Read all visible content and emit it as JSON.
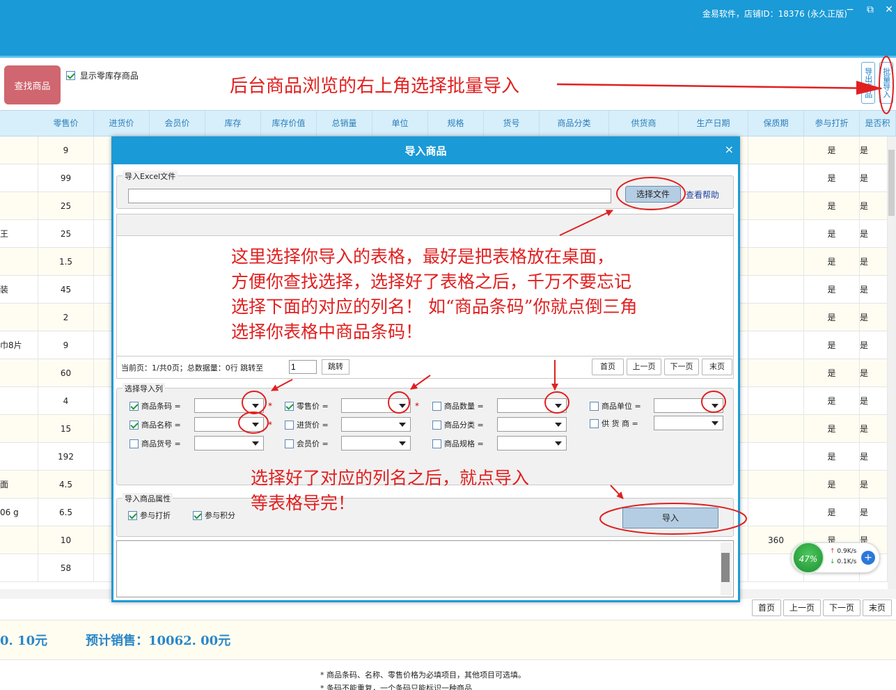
{
  "titlebar": {
    "text": "金易软件，店铺ID：18376 (永久正版)",
    "minimize": "−",
    "restore": "⧉",
    "close": "✕"
  },
  "toolbar": {
    "find_button": "查找商品",
    "show_zero_label": "显示零库存商品",
    "show_zero_checked": true,
    "export_label": "导出商品",
    "batch_import_label": "批量导入"
  },
  "table": {
    "columns": [
      "零售价",
      "进货价",
      "会员价",
      "库存",
      "库存价值",
      "总销量",
      "单位",
      "规格",
      "货号",
      "商品分类",
      "供货商",
      "生产日期",
      "保质期",
      "参与打折",
      "是否积"
    ],
    "name_fragments": [
      "",
      "",
      "",
      "王",
      "",
      "装",
      "",
      "巾8片",
      "",
      "",
      "",
      "",
      "面",
      "06 g",
      "",
      ""
    ],
    "retail_prices": [
      "9",
      "99",
      "25",
      "25",
      "1.5",
      "45",
      "2",
      "9",
      "60",
      "4",
      "15",
      "192",
      "4.5",
      "6.5",
      "10",
      "58"
    ],
    "shelf_life": [
      "",
      "",
      "",
      "",
      "",
      "",
      "",
      "",
      "",
      "",
      "",
      "",
      "",
      "",
      "360",
      ""
    ],
    "discount": [
      "是",
      "是",
      "是",
      "是",
      "是",
      "是",
      "是",
      "是",
      "是",
      "是",
      "是",
      "是",
      "是",
      "是",
      "是",
      "是"
    ],
    "points": [
      "是",
      "是",
      "是",
      "是",
      "是",
      "是",
      "是",
      "是",
      "是",
      "是",
      "是",
      "是",
      "是",
      "是",
      "是",
      "是"
    ]
  },
  "pager": {
    "first": "首页",
    "prev": "上一页",
    "next": "下一页",
    "last": "末页"
  },
  "footer": {
    "amount": "0. 10元",
    "expected_sales": "预计销售：10062. 00元",
    "note1": "* 商品条码、名称、零售价格为必填项目，其他项目可选填。",
    "note2": "* 条码不能重复，一个条码只能标识一种商品"
  },
  "dialog": {
    "title": "导入商品",
    "close": "×",
    "excel_group": "导入Excel文件",
    "file_value": "",
    "select_file": "选择文件",
    "help": "查看帮助",
    "pager_text": "当前页：1/共0页；总数据量：0行   跳转至",
    "jump_value": "1",
    "jump_btn": "跳转",
    "pager_first": "首页",
    "pager_prev": "上一页",
    "pager_next": "下一页",
    "pager_last": "末页",
    "columns_group": "选择导入列",
    "fields": {
      "barcode": {
        "label": "商品条码 =",
        "checked": true
      },
      "retail": {
        "label": "零售价 =",
        "checked": true
      },
      "qty": {
        "label": "商品数量 =",
        "checked": false
      },
      "unit": {
        "label": "商品单位 =",
        "checked": false
      },
      "name": {
        "label": "商品名称 =",
        "checked": true
      },
      "purchase": {
        "label": "进货价 =",
        "checked": false
      },
      "category": {
        "label": "商品分类 =",
        "checked": false
      },
      "supplier": {
        "label": "供 货 商 =",
        "checked": false
      },
      "itemno": {
        "label": "商品货号 =",
        "checked": false
      },
      "member": {
        "label": "会员价 =",
        "checked": false
      },
      "spec": {
        "label": "商品规格 =",
        "checked": false
      }
    },
    "required_mark": "*",
    "attr_group": "导入商品属性",
    "attr_discount": "参与打折",
    "attr_points": "参与积分",
    "import_btn": "导入"
  },
  "annotations": {
    "top": "后台商品浏览的右上角选择批量导入",
    "middle_1": "这里选择你导入的表格，最好是把表格放在桌面，",
    "middle_2": "方便你查找选择，选择好了表格之后，千万不要忘记",
    "middle_3": "选择下面的对应的列名！ 如“商品条码”你就点倒三角",
    "middle_4": "选择你表格中商品条码！",
    "bottom_1": "选择好了对应的列名之后，就点导入",
    "bottom_2": "等表格导完！"
  },
  "net_widget": {
    "percent": "47%",
    "up": "0.9K/s",
    "down": "0.1K/s",
    "up_arrow": "↑",
    "down_arrow": "↓",
    "plus": "+"
  }
}
